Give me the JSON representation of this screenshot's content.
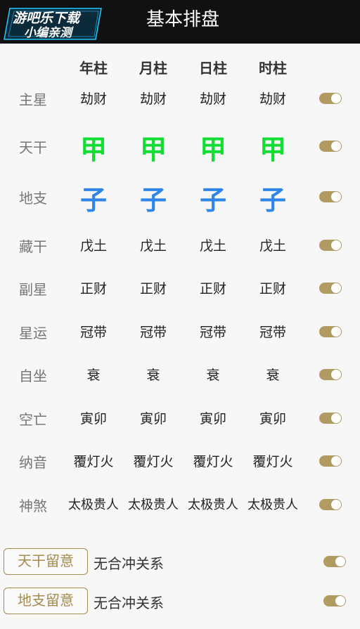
{
  "header": {
    "title": "基本排盘",
    "watermark": {
      "line1": "游吧乐下载",
      "line2": "小编亲测"
    }
  },
  "table": {
    "columns": [
      "年柱",
      "月柱",
      "日柱",
      "时柱"
    ],
    "rows": [
      {
        "label": "主星",
        "values": [
          "劫财",
          "劫财",
          "劫财",
          "劫财"
        ],
        "toggle": true
      },
      {
        "label": "天干",
        "values": [
          "甲",
          "甲",
          "甲",
          "甲"
        ],
        "toggle": true
      },
      {
        "label": "地支",
        "values": [
          "子",
          "子",
          "子",
          "子"
        ],
        "toggle": true
      },
      {
        "label": "藏干",
        "values": [
          "戊土",
          "戊土",
          "戊土",
          "戊土"
        ],
        "toggle": true
      },
      {
        "label": "副星",
        "values": [
          "正财",
          "正财",
          "正财",
          "正财"
        ],
        "toggle": true
      },
      {
        "label": "星运",
        "values": [
          "冠带",
          "冠带",
          "冠带",
          "冠带"
        ],
        "toggle": true
      },
      {
        "label": "自坐",
        "values": [
          "衰",
          "衰",
          "衰",
          "衰"
        ],
        "toggle": true
      },
      {
        "label": "空亡",
        "values": [
          "寅卯",
          "寅卯",
          "寅卯",
          "寅卯"
        ],
        "toggle": true
      },
      {
        "label": "纳音",
        "values": [
          "覆灯火",
          "覆灯火",
          "覆灯火",
          "覆灯火"
        ],
        "toggle": true
      },
      {
        "label": "神煞",
        "values": [
          "太极贵人",
          "太极贵人",
          "太极贵人",
          "太极贵人"
        ],
        "toggle": true
      }
    ]
  },
  "notes": [
    {
      "button": "天干留意",
      "text": "无合冲关系",
      "toggle": true
    },
    {
      "button": "地支留意",
      "text": "无合冲关系",
      "toggle": true
    }
  ],
  "colors": {
    "header_bg": "#111111",
    "tiangan": "#11dd33",
    "dizhi": "#2f86e8",
    "accent": "#b29a63"
  }
}
